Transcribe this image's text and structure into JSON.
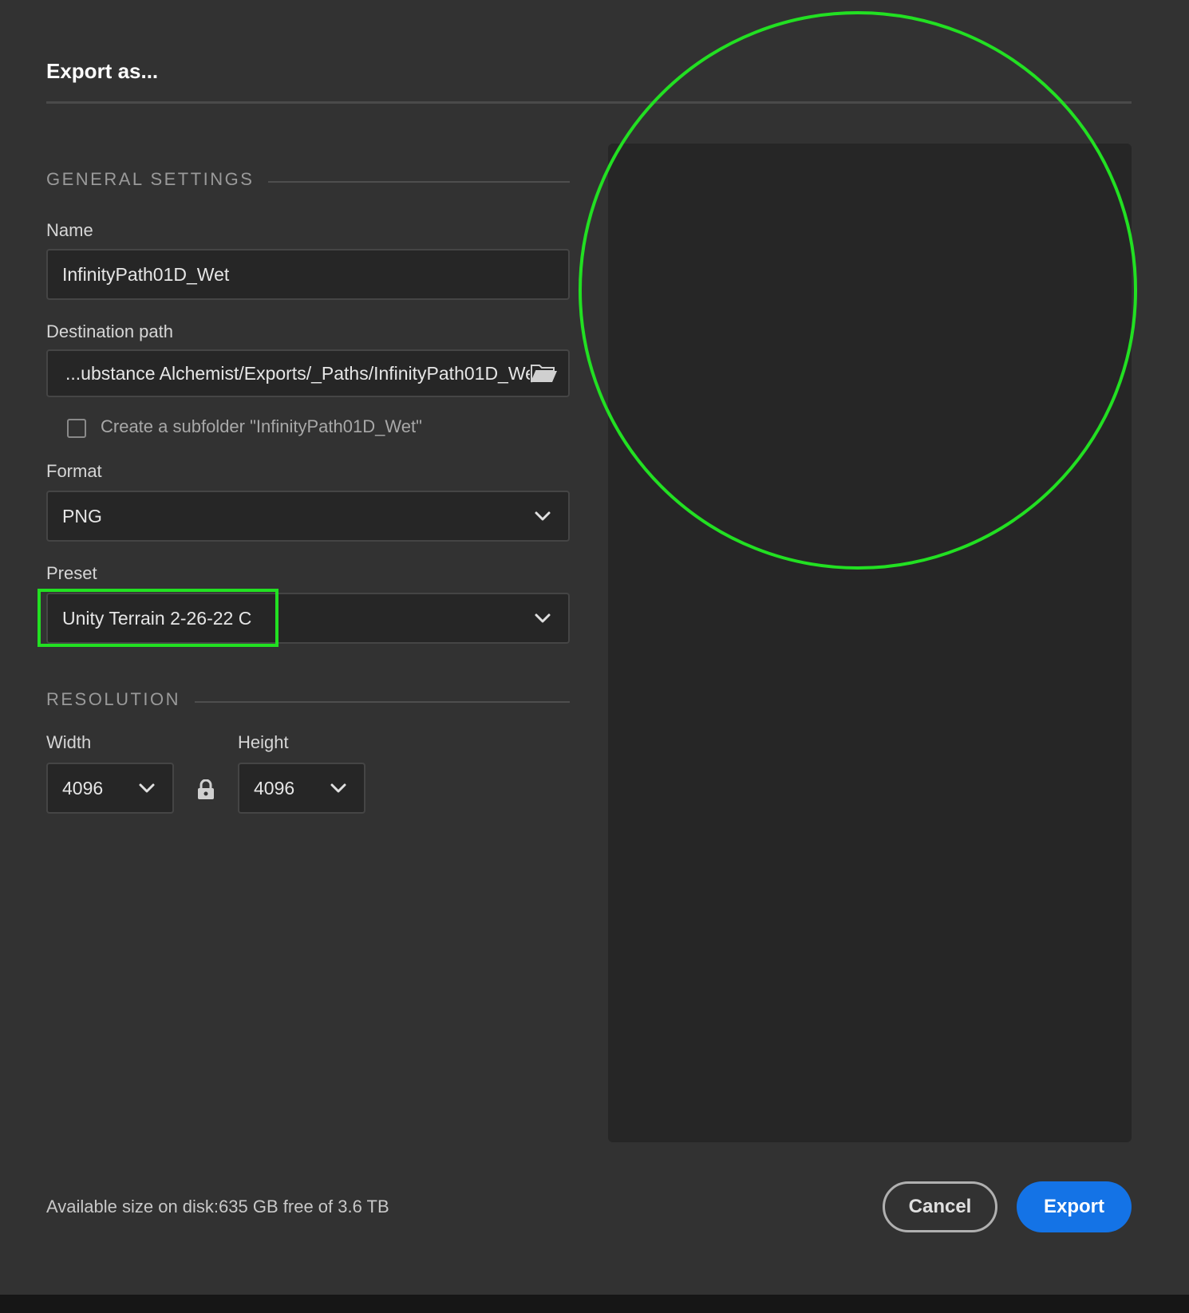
{
  "dialog": {
    "title": "Export as..."
  },
  "general_settings": {
    "heading": "GENERAL SETTINGS",
    "name_label": "Name",
    "name_value": "InfinityPath01D_Wet",
    "destination_label": "Destination path",
    "destination_value": "...ubstance Alchemist/Exports/_Paths/InfinityPath01D_Wet",
    "subfolder_label": "Create a subfolder \"InfinityPath01D_Wet\"",
    "subfolder_checked": false,
    "format_label": "Format",
    "format_value": "PNG",
    "preset_label": "Preset",
    "preset_value": "Unity Terrain 2-26-22 C"
  },
  "resolution": {
    "heading": "RESOLUTION",
    "width_label": "Width",
    "width_value": "4096",
    "height_label": "Height",
    "height_value": "4096"
  },
  "footer": {
    "disk_info": "Available size on disk:635 GB free of 3.6 TB",
    "cancel_label": "Cancel",
    "export_label": "Export"
  },
  "colors": {
    "accent": "#1473e6",
    "annotation": "#22e022",
    "background": "#323232"
  }
}
